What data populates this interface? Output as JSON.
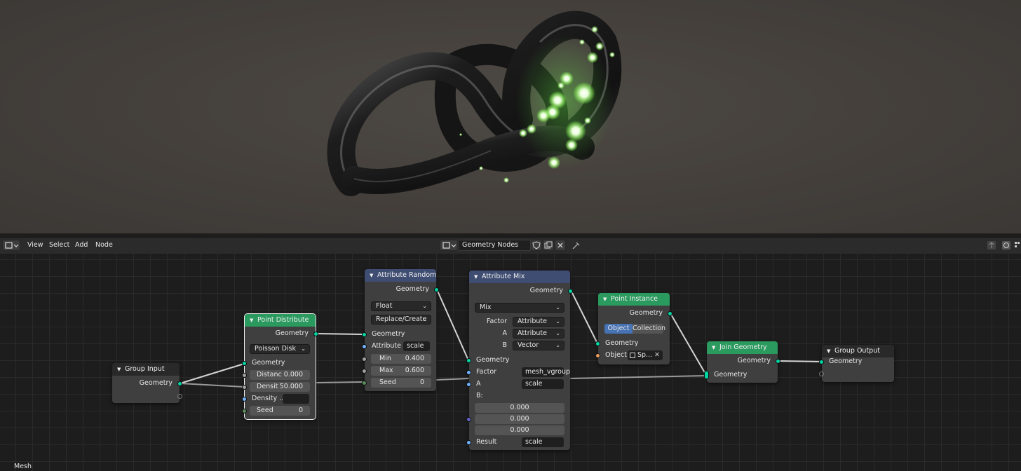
{
  "header": {
    "menus": [
      "View",
      "Select",
      "Add",
      "Node"
    ],
    "node_tree_name": "Geometry Nodes",
    "icons": [
      "editor-type-icon",
      "node-tree-icon",
      "fake-user-shield-icon",
      "duplicate-icon",
      "close-icon",
      "pin-icon",
      "parent-up-icon",
      "snap-icon",
      "overlay-icon"
    ]
  },
  "nodes": {
    "group_input": {
      "title": "Group Input",
      "out_geometry": "Geometry"
    },
    "point_distribute": {
      "title": "Point Distribute",
      "out_geometry": "Geometry",
      "method": "Poisson Disk",
      "in_geometry": "Geometry",
      "distance_label": "Distanc",
      "distance_value": "0.000",
      "density_label": "Densit",
      "density_value": "50.000",
      "density_attr_label": "Density ...",
      "seed_label": "Seed",
      "seed_value": "0"
    },
    "attribute_randomize": {
      "title": "Attribute Randomize",
      "out_geometry": "Geometry",
      "data_type": "Float",
      "operation": "Replace/Create",
      "in_geometry": "Geometry",
      "attribute_label": "Attribute",
      "attribute_value": "scale",
      "min_label": "Min",
      "min_value": "0.400",
      "max_label": "Max",
      "max_value": "0.600",
      "seed_label": "Seed",
      "seed_value": "0"
    },
    "attribute_mix": {
      "title": "Attribute Mix",
      "out_geometry": "Geometry",
      "blend_type": "Mix",
      "factor_label": "Factor",
      "factor_type": "Attribute",
      "a_label": "A",
      "a_type": "Attribute",
      "b_label": "B",
      "b_type": "Vector",
      "in_geometry": "Geometry",
      "factor_in_label": "Factor",
      "factor_in_value": "mesh_vgroup",
      "a_in_label": "A",
      "a_in_value": "scale",
      "b_in_label": "B:",
      "b_x": "0.000",
      "b_y": "0.000",
      "b_z": "0.000",
      "result_label": "Result",
      "result_value": "scale"
    },
    "point_instance": {
      "title": "Point Instance",
      "out_geometry": "Geometry",
      "mode_object": "Object",
      "mode_collection": "Collection",
      "in_geometry": "Geometry",
      "object_label": "Object:",
      "object_value": "Sp..."
    },
    "join_geometry": {
      "title": "Join Geometry",
      "out_geometry": "Geometry",
      "in_geometry": "Geometry"
    },
    "group_output": {
      "title": "Group Output",
      "in_geometry": "Geometry"
    }
  },
  "status": {
    "context_label": "Mesh"
  },
  "colors": {
    "geometry_socket": "#00d6a3",
    "header_geometry": "#2b9a5f",
    "header_attribute": "#3f4d72",
    "glow": "#b6ff8a"
  }
}
